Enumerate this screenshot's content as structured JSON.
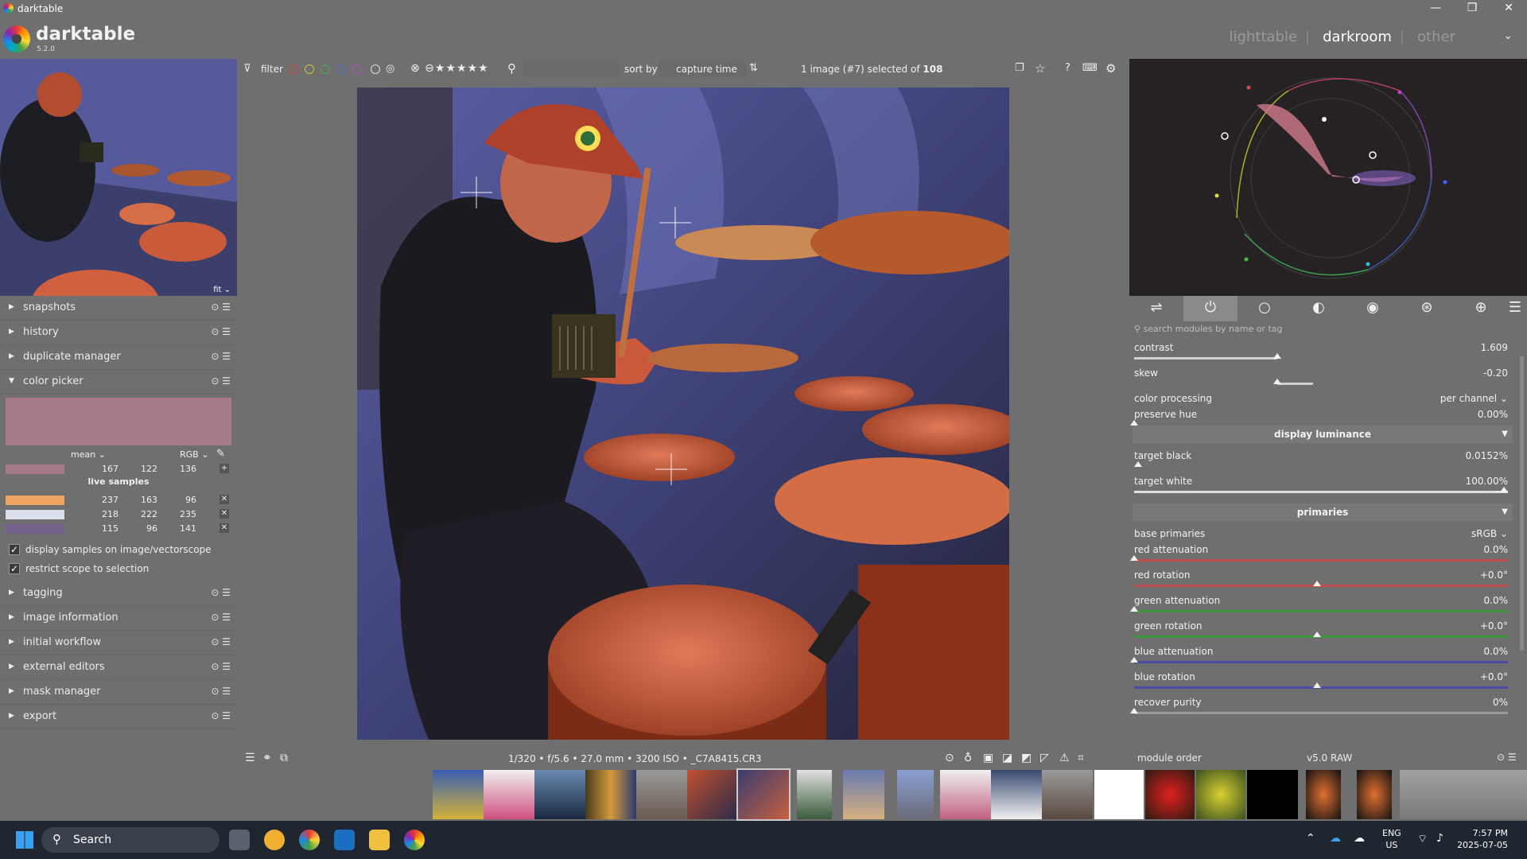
{
  "window": {
    "title": "darktable"
  },
  "header": {
    "app_name": "darktable",
    "version": "5.2.0",
    "views": [
      "lighttable",
      "darkroom",
      "other"
    ],
    "active_view": "darkroom"
  },
  "left": {
    "modules": [
      "snapshots",
      "history",
      "duplicate manager",
      "color picker"
    ],
    "picker": {
      "mode": "mean",
      "space": "RGB",
      "mean_values": [
        "167",
        "122",
        "136"
      ],
      "live_samples_label": "live samples",
      "samples": [
        {
          "color": "#eea360",
          "values": [
            "237",
            "163",
            "96"
          ]
        },
        {
          "color": "#dadeeb",
          "values": [
            "218",
            "222",
            "235"
          ]
        },
        {
          "color": "#73608d",
          "values": [
            "115",
            "96",
            "141"
          ]
        }
      ],
      "swatch_color": "#a77a88",
      "opt1": "display samples on image/vectorscope",
      "opt2": "restrict scope to selection"
    },
    "modules_bottom": [
      "tagging",
      "image information",
      "initial workflow",
      "external editors",
      "mask manager",
      "export"
    ],
    "nav_zoom": "fit"
  },
  "topbar": {
    "filter_label": "filter",
    "sort_label": "sort by",
    "sort_value": "capture time",
    "count_prefix": "1 image (#7) selected of",
    "count_total": "108"
  },
  "bottombar": {
    "image_info": "1/320 • f/5.6 • 27.0 mm • 3200 ISO • _C7A8415.CR3"
  },
  "right": {
    "search_placeholder": "search modules by name or tag",
    "params": {
      "contrast": {
        "label": "contrast",
        "value": "1.609"
      },
      "skew": {
        "label": "skew",
        "value": "-0.20"
      },
      "color_processing": {
        "label": "color processing",
        "value": "per channel"
      },
      "preserve_hue": {
        "label": "preserve hue",
        "value": "0.00%"
      },
      "sec_display": "display luminance",
      "target_black": {
        "label": "target black",
        "value": "0.0152%"
      },
      "target_white": {
        "label": "target white",
        "value": "100.00%"
      },
      "sec_primaries": "primaries",
      "base_primaries": {
        "label": "base primaries",
        "value": "sRGB"
      },
      "red_attenuation": {
        "label": "red attenuation",
        "value": "0.0%"
      },
      "red_rotation": {
        "label": "red rotation",
        "value": "+0.0°"
      },
      "green_attenuation": {
        "label": "green attenuation",
        "value": "0.0%"
      },
      "green_rotation": {
        "label": "green rotation",
        "value": "+0.0°"
      },
      "blue_attenuation": {
        "label": "blue attenuation",
        "value": "0.0%"
      },
      "blue_rotation": {
        "label": "blue rotation",
        "value": "+0.0°"
      },
      "recover_purity": {
        "label": "recover purity",
        "value": "0%"
      }
    },
    "module_order_label": "module order",
    "module_order_value": "v5.0 RAW"
  },
  "taskbar": {
    "search": "Search",
    "lang1": "ENG",
    "lang2": "US",
    "time": "7:57 PM",
    "date": "2025-07-05"
  },
  "colors": {
    "background": "#6f6f6f",
    "accent_red": "#c0504d",
    "accent_green": "#3c9a3c",
    "accent_blue": "#4a4aa8"
  }
}
